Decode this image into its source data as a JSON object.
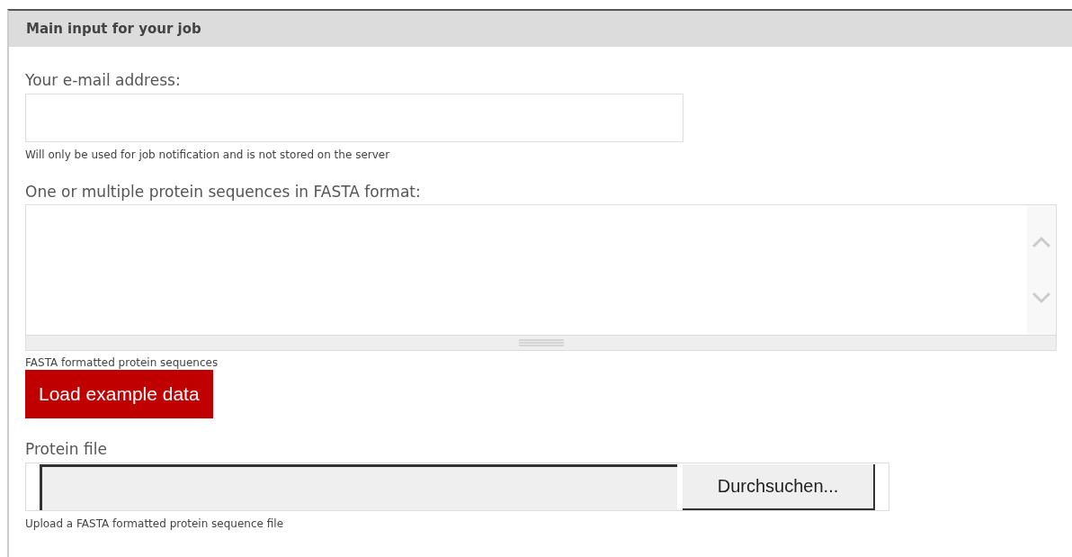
{
  "panel": {
    "title": "Main input for your job"
  },
  "email": {
    "label": "Your e-mail address:",
    "help": "Will only be used for job notification and is not stored on the server"
  },
  "sequences": {
    "label": "One or multiple protein sequences in FASTA format:",
    "help": "FASTA formatted protein sequences"
  },
  "example_button": "Load example data",
  "file": {
    "label": "Protein file",
    "browse_button": "Durchsuchen...",
    "help": "Upload a FASTA formatted protein sequence file"
  }
}
